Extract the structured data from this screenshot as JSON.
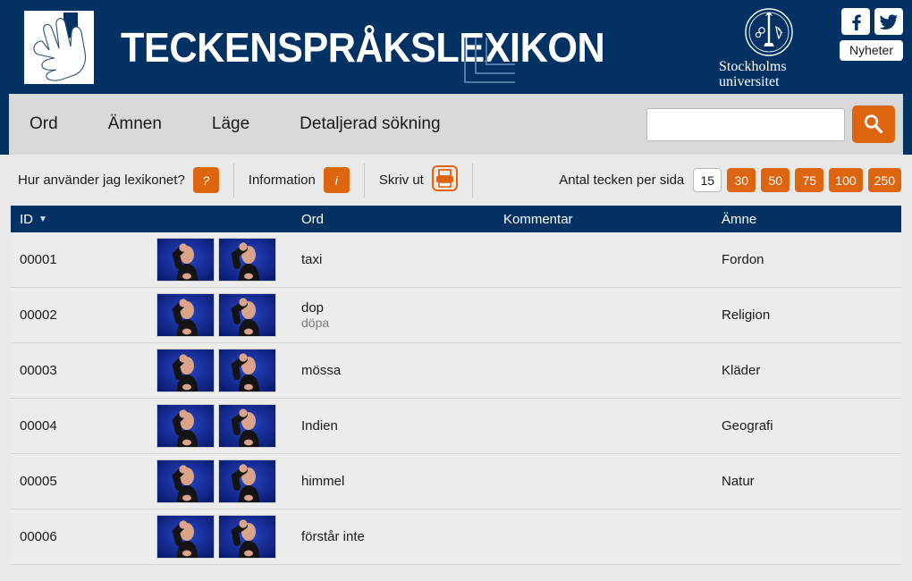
{
  "header": {
    "site_title": "TECKENSPRÅKSLEXIKON",
    "logo_icon": "hands-logo-icon",
    "university": {
      "seal_icon": "stockholm-university-seal-icon",
      "name_line1": "Stockholms",
      "name_line2": "universitet"
    },
    "social": {
      "facebook_icon": "facebook-icon",
      "twitter_icon": "twitter-icon",
      "news_label": "Nyheter"
    }
  },
  "nav": {
    "items": [
      {
        "label": "Ord"
      },
      {
        "label": "Ämnen"
      },
      {
        "label": "Läge"
      },
      {
        "label": "Detaljerad sökning"
      }
    ],
    "search": {
      "value": "",
      "placeholder": "",
      "button_icon": "search-icon"
    }
  },
  "toolbar": {
    "help_label": "Hur använder jag lexikonet?",
    "help_badge": "?",
    "info_label": "Information",
    "info_badge": "i",
    "print_label": "Skriv ut",
    "print_icon": "printer-icon",
    "pager_label": "Antal tecken per sida",
    "page_sizes": [
      {
        "value": "15",
        "active": true
      },
      {
        "value": "30",
        "active": false
      },
      {
        "value": "50",
        "active": false
      },
      {
        "value": "75",
        "active": false
      },
      {
        "value": "100",
        "active": false
      },
      {
        "value": "250",
        "active": false
      }
    ]
  },
  "table": {
    "columns": {
      "id": "ID",
      "id_sort": "▼",
      "images": "",
      "word": "Ord",
      "comment": "Kommentar",
      "subject": "Ämne"
    },
    "rows": [
      {
        "id": "00001",
        "word": "taxi",
        "synonym": "",
        "comment": "",
        "subject": "Fordon"
      },
      {
        "id": "00002",
        "word": "dop",
        "synonym": "döpa",
        "comment": "",
        "subject": "Religion"
      },
      {
        "id": "00003",
        "word": "mössa",
        "synonym": "",
        "comment": "",
        "subject": "Kläder"
      },
      {
        "id": "00004",
        "word": "Indien",
        "synonym": "",
        "comment": "",
        "subject": "Geografi"
      },
      {
        "id": "00005",
        "word": "himmel",
        "synonym": "",
        "comment": "",
        "subject": "Natur"
      },
      {
        "id": "00006",
        "word": "förstår inte",
        "synonym": "",
        "comment": "",
        "subject": ""
      }
    ]
  },
  "colors": {
    "brand_navy": "#023163",
    "accent_orange": "#dd6510",
    "nav_grey": "#d9d9d9",
    "page_grey": "#e9e9e9",
    "row_grey": "#ececec"
  }
}
